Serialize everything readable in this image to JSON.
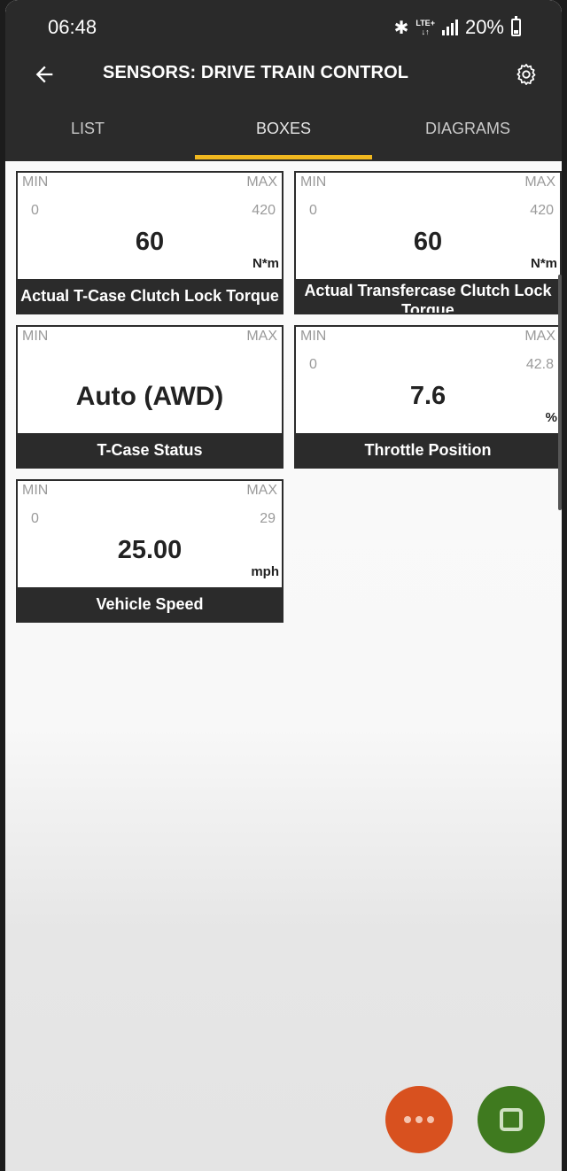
{
  "status_bar": {
    "time": "06:48",
    "network": "LTE+",
    "battery": "20%"
  },
  "app_bar": {
    "title": "SENSORS: DRIVE TRAIN CONTROL",
    "back_icon": "arrow-left-icon",
    "settings_icon": "gear-icon"
  },
  "tabs": [
    {
      "label": "LIST",
      "selected": false
    },
    {
      "label": "BOXES",
      "selected": true
    },
    {
      "label": "DIAGRAMS",
      "selected": false
    }
  ],
  "colors": {
    "accent": "#f1b81f",
    "more_fab": "#d8511f",
    "stop_fab": "#3f7a1f"
  },
  "boxes": [
    {
      "min_label": "MIN",
      "max_label": "MAX",
      "min": "0",
      "max": "420",
      "value": "60",
      "unit": "N*m",
      "name": "Actual T-Case Clutch Lock Torque"
    },
    {
      "min_label": "MIN",
      "max_label": "MAX",
      "min": "0",
      "max": "420",
      "value": "60",
      "unit": "N*m",
      "name": "Actual Transfercase Clutch Lock Torque"
    },
    {
      "min_label": "MIN",
      "max_label": "MAX",
      "value": "Auto (AWD)",
      "name": "T-Case Status"
    },
    {
      "min_label": "MIN",
      "max_label": "MAX",
      "min": "0",
      "max": "42.8",
      "value": "7.6",
      "unit": "%",
      "name": "Throttle Position"
    },
    {
      "min_label": "MIN",
      "max_label": "MAX",
      "min": "0",
      "max": "29",
      "value": "25.00",
      "unit": "mph",
      "name": "Vehicle Speed"
    }
  ],
  "fabs": {
    "more_icon": "more-dots-icon",
    "stop_icon": "stop-icon"
  }
}
